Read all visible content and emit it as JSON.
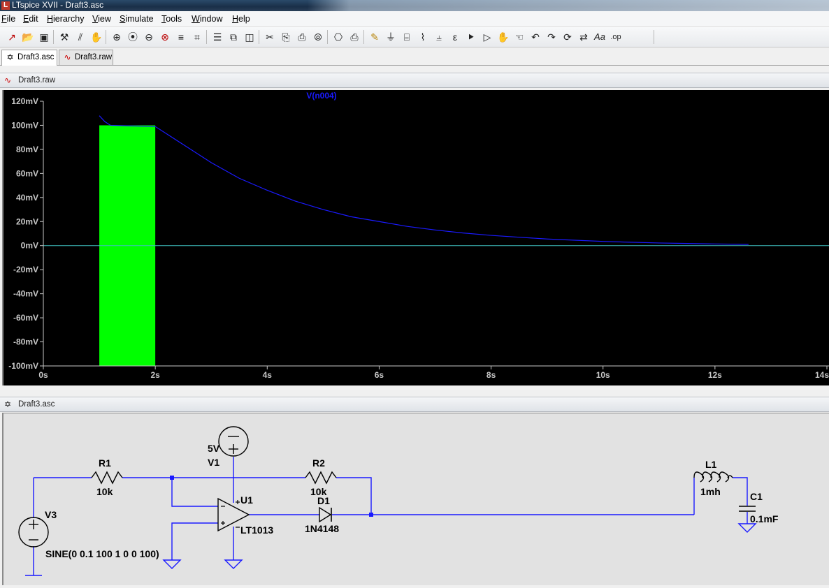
{
  "window": {
    "title": "LTspice XVII - Draft3.asc",
    "app_icon": "ltspice-logo-icon"
  },
  "menu": [
    {
      "label": "File",
      "mnemonic": "F",
      "rest": "ile"
    },
    {
      "label": "Edit",
      "mnemonic": "E",
      "rest": "dit"
    },
    {
      "label": "Hierarchy",
      "mnemonic": "H",
      "rest": "ierarchy"
    },
    {
      "label": "View",
      "mnemonic": "V",
      "rest": "iew"
    },
    {
      "label": "Simulate",
      "mnemonic": "S",
      "rest": "imulate"
    },
    {
      "label": "Tools",
      "mnemonic": "T",
      "rest": "ools"
    },
    {
      "label": "Window",
      "mnemonic": "W",
      "rest": "indow"
    },
    {
      "label": "Help",
      "mnemonic": "H",
      "rest": "elp"
    }
  ],
  "toolbar": {
    "icons": [
      "new-schematic-icon",
      "open-icon",
      "save-icon",
      "control-panel-icon",
      "run-icon",
      "halt-icon",
      "zoom-in-icon",
      "zoom-full-icon",
      "zoom-out-icon",
      "zoom-cancel-icon",
      "autorange-icon",
      "grid-icon",
      "tile-horizontal-icon",
      "cascade-icon",
      "tile-vertical-icon",
      "cut-icon",
      "copy-icon",
      "paste-icon",
      "find-icon",
      "print-setup-icon",
      "print-icon",
      "wire-icon",
      "ground-icon",
      "label-net-icon",
      "resistor-icon",
      "capacitor-icon",
      "inductor-icon",
      "diode-icon",
      "component-icon",
      "move-icon",
      "drag-icon",
      "undo-icon",
      "redo-icon",
      "rotate-icon",
      "mirror-icon",
      "text-icon",
      "spice-directive-icon"
    ],
    "text_label": "Aa",
    "op_label": ".op"
  },
  "tabs": [
    {
      "label": "Draft3.asc",
      "icon": "schematic-icon",
      "active": true
    },
    {
      "label": "Draft3.raw",
      "icon": "waveform-icon",
      "active": false
    }
  ],
  "waveform_pane": {
    "title": "Draft3.raw",
    "icon": "waveform-icon"
  },
  "schematic_pane": {
    "title": "Draft3.asc",
    "icon": "schematic-icon"
  },
  "chart_data": {
    "type": "line",
    "title": "V(n004)",
    "xlabel": "",
    "ylabel": "",
    "x_ticks": [
      "0s",
      "2s",
      "4s",
      "6s",
      "8s",
      "10s",
      "12s",
      "14s"
    ],
    "y_ticks": [
      "120mV",
      "100mV",
      "80mV",
      "60mV",
      "40mV",
      "20mV",
      "0mV",
      "-20mV",
      "-40mV",
      "-60mV",
      "-80mV",
      "-100mV"
    ],
    "xlim": [
      0,
      14
    ],
    "ylim": [
      -100,
      120
    ],
    "grid": false,
    "colors": {
      "background": "#000000",
      "trace": "#1a1aff",
      "burst": "#00ff00",
      "zero_line": "#3fbfbf",
      "axis": "#c8c8c8"
    },
    "burst": {
      "x_start": 1.0,
      "x_end": 2.0,
      "y_min": -100,
      "y_max": 100
    },
    "series": [
      {
        "name": "V(n004)",
        "x": [
          1.0,
          1.1,
          1.2,
          2.0,
          2.5,
          3.0,
          3.5,
          4.0,
          4.5,
          5.0,
          5.5,
          6.0,
          6.5,
          7.0,
          7.5,
          8.0,
          8.5,
          9.0,
          9.5,
          10.0,
          10.5,
          11.0,
          11.5,
          12.0,
          12.6
        ],
        "y": [
          108,
          103,
          100,
          99,
          84,
          69,
          56,
          46,
          37,
          30,
          24,
          20,
          16,
          13,
          10.5,
          8.5,
          7,
          5.5,
          4.5,
          3.5,
          2.8,
          2.2,
          1.8,
          1.4,
          1.0
        ]
      }
    ]
  },
  "schematic": {
    "parts": {
      "r1": {
        "ref": "R1",
        "value": "10k"
      },
      "r2": {
        "ref": "R2",
        "value": "10k"
      },
      "v1": {
        "ref": "V1",
        "value": "5V"
      },
      "v3": {
        "ref": "V3",
        "value": "SINE(0 0.1 100 1 0 0 100)"
      },
      "u1": {
        "ref": "U1",
        "value": "LT1013"
      },
      "d1": {
        "ref": "D1",
        "value": "1N4148"
      },
      "l1": {
        "ref": "L1",
        "value": "1mh"
      },
      "c1": {
        "ref": "C1",
        "value": "0.1mF"
      }
    },
    "colors": {
      "wire": "#1a1aff",
      "background": "#e2e2e2",
      "symbol": "#1a1aff"
    }
  }
}
